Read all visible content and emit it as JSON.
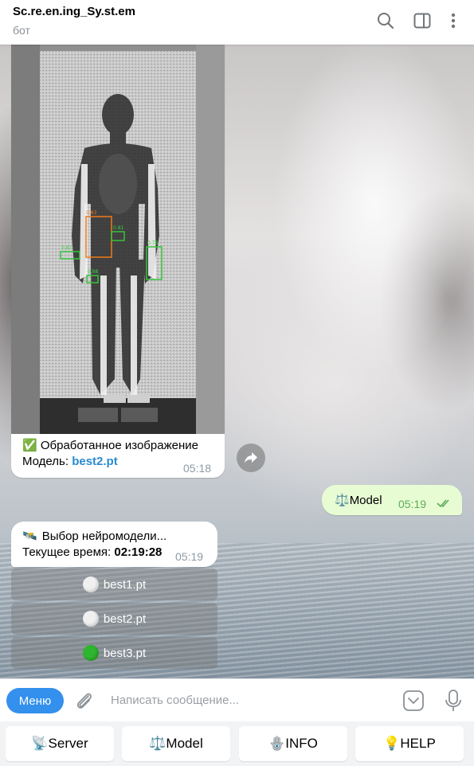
{
  "header": {
    "title": "Sc.re.en.ing_Sy.st.em",
    "subtitle": "бот",
    "icons": [
      "search-icon",
      "sidebar-panel-icon",
      "more-vertical-icon"
    ]
  },
  "messages": {
    "image_message": {
      "detection_labels": [
        "0.83",
        "0.81",
        "0.87",
        "0.78",
        "0.88"
      ],
      "caption_emoji": "✅",
      "caption_text": "Обработанное изображение",
      "model_label": "Модель:",
      "model_name": "best2.pt",
      "time": "05:18"
    },
    "outgoing": {
      "emoji": "⚖️",
      "text": "Model",
      "time": "05:19"
    },
    "incoming": {
      "emoji": "🛰️",
      "line1": "Выбор нейромодели...",
      "line2_label": "Текущее время:",
      "line2_value": "02:19:28",
      "time": "05:19"
    },
    "inline_keyboard": [
      {
        "label": "best1.pt",
        "state": "white",
        "color": "#f0f0f0"
      },
      {
        "label": "best2.pt",
        "state": "white",
        "color": "#f0f0f0"
      },
      {
        "label": "best3.pt",
        "state": "green",
        "color": "#2fb52f"
      }
    ]
  },
  "input": {
    "menu_label": "Меню",
    "placeholder": "Написать сообщение..."
  },
  "reply_keyboard": [
    {
      "emoji": "📡",
      "label": "Server"
    },
    {
      "emoji": "⚖️",
      "label": "Model"
    },
    {
      "emoji": "🪬",
      "label": "INFO"
    },
    {
      "emoji": "💡",
      "label": "HELP"
    }
  ],
  "colors": {
    "accent": "#3390ec",
    "link": "#2a8bd1",
    "outgoing_bubble": "#e8fcd4",
    "outgoing_time": "#5dab5a"
  }
}
